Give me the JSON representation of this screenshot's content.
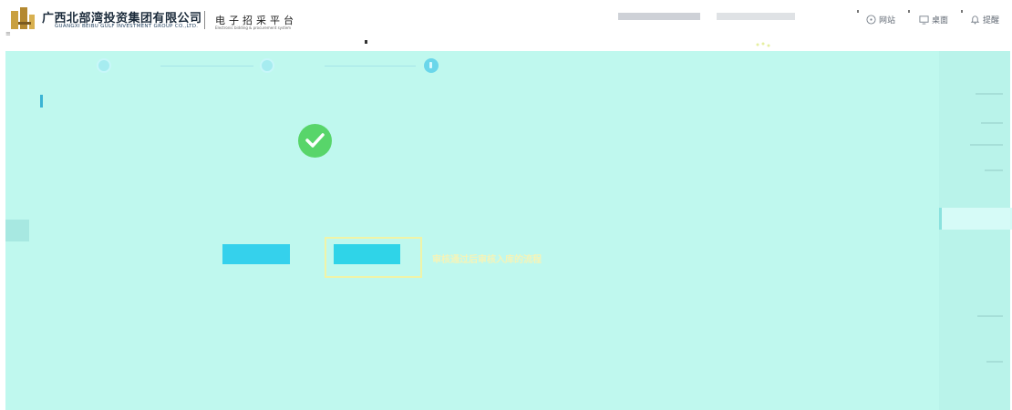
{
  "header": {
    "company_name_cn": "广西北部湾投资集团有限公司",
    "company_name_en": "GUANGXI BEIBU GULF INVESTMENT GROUP CO.,LTD.",
    "platform_title": "电子招采平台",
    "platform_subtitle": "Electronic bidding & procurement system",
    "links": {
      "website": "网站",
      "desktop": "桌面",
      "reminder": "提醒"
    }
  },
  "stepper": {
    "steps": [
      {
        "label": "",
        "state": "done"
      },
      {
        "label": "",
        "state": "done"
      },
      {
        "label": "",
        "state": "active"
      }
    ]
  },
  "result": {
    "title": "",
    "description": "",
    "back_button": "",
    "next_button": ""
  },
  "annotation": {
    "text": "审核通过后审核入库的流程"
  },
  "colors": {
    "panel_bg": "#bff8ee",
    "button_cyan": "#35d1ec",
    "success_green": "#58d56a",
    "annotation_yellow": "#f5f4b8"
  },
  "icons": {
    "website": "globe-icon",
    "desktop": "monitor-icon",
    "reminder": "bell-icon",
    "success": "check-circle-icon"
  }
}
